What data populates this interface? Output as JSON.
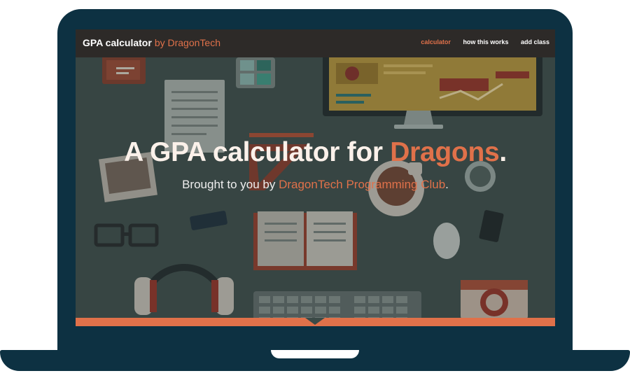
{
  "brand": {
    "title": "GPA calculator",
    "byline": "by DragonTech"
  },
  "nav": {
    "items": [
      "calculator",
      "how this works",
      "add class"
    ],
    "active": "calculator"
  },
  "hero": {
    "headline_pre": "A GPA calculator for ",
    "headline_accent": "Dragons",
    "headline_post": ".",
    "sub_pre": "Brought to you by ",
    "sub_accent": "DragonTech Programming Club",
    "sub_post": "."
  },
  "colors": {
    "accent": "#e0714a",
    "navbar": "#2d2a28",
    "device": "#0d3142",
    "hero_bg": "#3b4a47"
  }
}
